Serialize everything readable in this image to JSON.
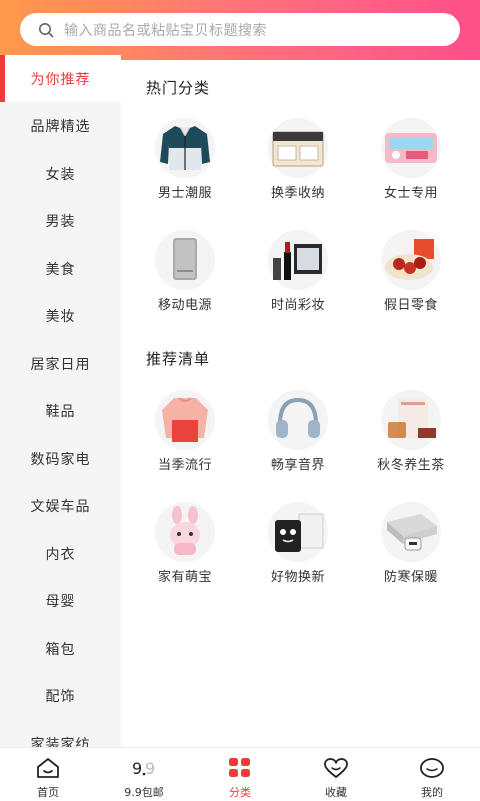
{
  "search": {
    "placeholder": "输入商品名或粘贴宝贝标题搜索"
  },
  "sidebar": {
    "items": [
      {
        "label": "为你推荐"
      },
      {
        "label": "品牌精选"
      },
      {
        "label": "女装"
      },
      {
        "label": "男装"
      },
      {
        "label": "美食"
      },
      {
        "label": "美妆"
      },
      {
        "label": "居家日用"
      },
      {
        "label": "鞋品"
      },
      {
        "label": "数码家电"
      },
      {
        "label": "文娱车品"
      },
      {
        "label": "内衣"
      },
      {
        "label": "母婴"
      },
      {
        "label": "箱包"
      },
      {
        "label": "配饰"
      },
      {
        "label": "家装家纺"
      }
    ]
  },
  "sections": [
    {
      "title": "热门分类",
      "items": [
        {
          "label": "男士潮服",
          "icon": "jacket-image"
        },
        {
          "label": "换季收纳",
          "icon": "storage-box-image"
        },
        {
          "label": "女士专用",
          "icon": "sanitary-pad-image"
        },
        {
          "label": "移动电源",
          "icon": "power-bank-image"
        },
        {
          "label": "时尚彩妆",
          "icon": "makeup-image"
        },
        {
          "label": "假日零食",
          "icon": "snacks-image"
        }
      ]
    },
    {
      "title": "推荐清单",
      "items": [
        {
          "label": "当季流行",
          "icon": "sweater-image"
        },
        {
          "label": "畅享音界",
          "icon": "headphones-image"
        },
        {
          "label": "秋冬养生茶",
          "icon": "tea-image"
        },
        {
          "label": "家有萌宝",
          "icon": "bunny-toy-image"
        },
        {
          "label": "好物换新",
          "icon": "cup-image"
        },
        {
          "label": "防寒保暖",
          "icon": "heated-pad-image"
        }
      ]
    }
  ],
  "tabbar": {
    "items": [
      {
        "label": "首页",
        "icon": "home-icon"
      },
      {
        "label": "9.9包邮",
        "icon": "nine-nine-icon"
      },
      {
        "label": "分类",
        "icon": "category-grid-icon"
      },
      {
        "label": "收藏",
        "icon": "heart-icon"
      },
      {
        "label": "我的",
        "icon": "profile-icon"
      }
    ],
    "active_color": "#f33a3a"
  },
  "colors": {
    "accent": "#f33a3a",
    "header_start": "#ff9a4a",
    "header_end": "#ff4f8a"
  }
}
